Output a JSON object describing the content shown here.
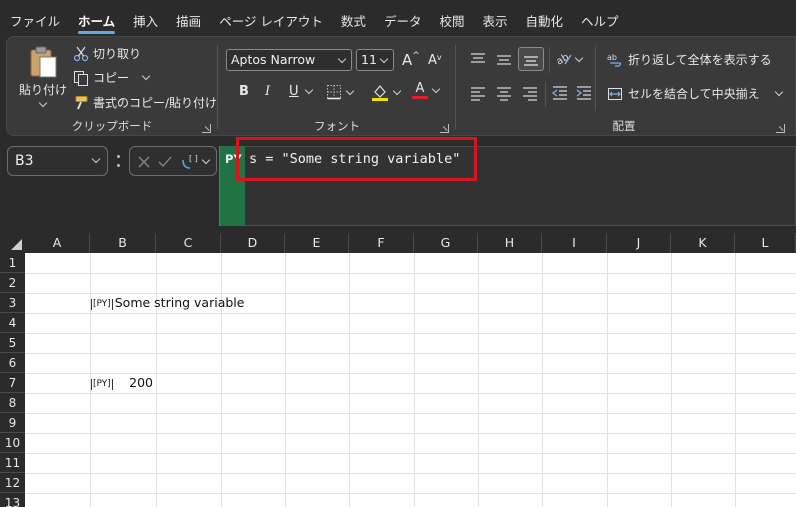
{
  "menu": {
    "tabs": [
      "ファイル",
      "ホーム",
      "挿入",
      "描画",
      "ページ レイアウト",
      "数式",
      "データ",
      "校閲",
      "表示",
      "自動化",
      "ヘルプ"
    ],
    "active_index": 1
  },
  "ribbon": {
    "clipboard": {
      "paste_label": "貼り付け",
      "cut_label": "切り取り",
      "copy_label": "コピー",
      "format_painter_label": "書式のコピー/貼り付け",
      "group_label": "クリップボード"
    },
    "font": {
      "font_name": "Aptos Narrow",
      "font_size": "11",
      "bold": "B",
      "italic": "I",
      "underline": "U",
      "increase_size": "A",
      "decrease_size": "A",
      "font_color": "A",
      "group_label": "フォント"
    },
    "alignment": {
      "wrap_text_label": "折り返して全体を表示する",
      "merge_center_label": "セルを結合して中央揃え",
      "group_label": "配置"
    }
  },
  "formula_bar": {
    "name_box": "B3",
    "py_badge": "PY",
    "formula": "s = \"Some string variable\""
  },
  "sheet": {
    "columns": [
      "A",
      "B",
      "C",
      "D",
      "E",
      "F",
      "G",
      "H",
      "I",
      "J",
      "K",
      "L"
    ],
    "rows": [
      "1",
      "2",
      "3",
      "4",
      "5",
      "6",
      "7",
      "8",
      "9",
      "10",
      "11",
      "12",
      "13"
    ],
    "py_tag": "[PY]",
    "cells": {
      "B3": "Some string variable",
      "B7": "200"
    }
  },
  "colors": {
    "accent_tab": "#66a8e0",
    "py_green": "#217346",
    "highlight_red": "#d9141c",
    "font_color_bar": "#e0202a",
    "fill_color_bar": "#f5e400"
  }
}
